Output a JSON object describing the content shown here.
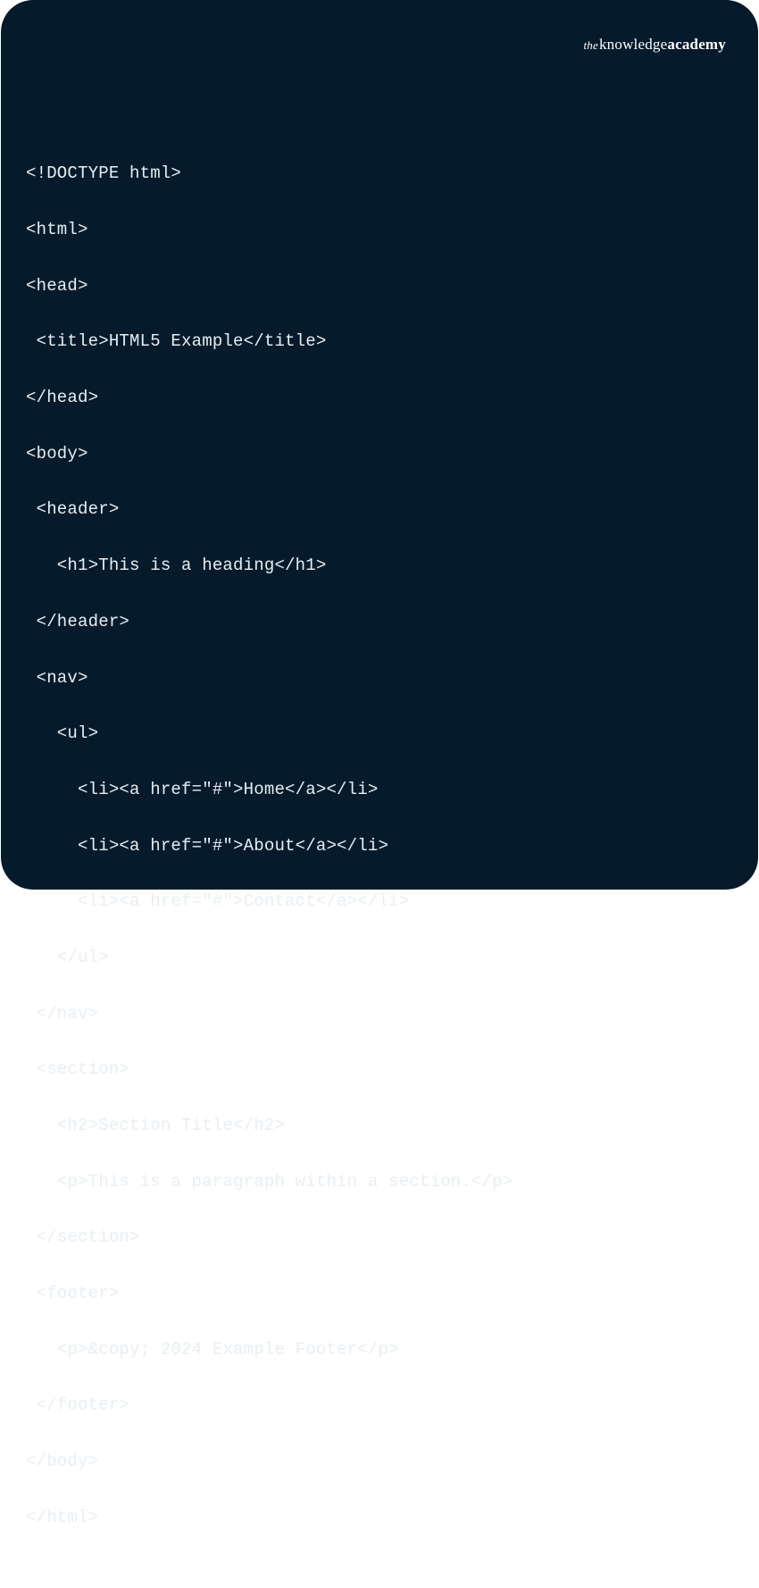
{
  "brand": {
    "the": "the",
    "knowledge": "knowledge",
    "academy": "academy"
  },
  "code": {
    "lines": [
      "<!DOCTYPE html>",
      "<html>",
      "<head>",
      " <title>HTML5 Example</title>",
      "</head>",
      "<body>",
      " <header>",
      "   <h1>This is a heading</h1>",
      " </header>",
      " <nav>",
      "   <ul>",
      "     <li><a href=\"#\">Home</a></li>",
      "     <li><a href=\"#\">About</a></li>",
      "     <li><a href=\"#\">Contact</a></li>",
      "   </ul>",
      " </nav>",
      " <section>",
      "   <h2>Section Title</h2>",
      "   <p>This is a paragraph within a section.</p>",
      " </section>",
      " <footer>",
      "   <p>&copy; 2024 Example Footer</p>",
      " </footer>",
      "</body>",
      "</html>"
    ]
  }
}
